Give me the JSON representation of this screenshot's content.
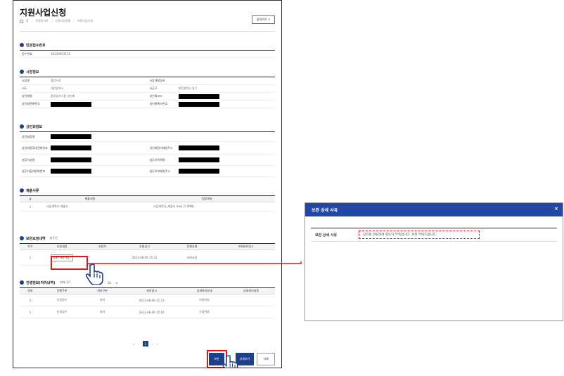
{
  "page": {
    "title": "지원사업신청",
    "breadcrumb": [
      "홈",
      "자원봉사자",
      "신청사업현황",
      "지원사업신청"
    ],
    "print_label": "출력하기 ↗"
  },
  "sections": {
    "receipt": {
      "title": "민원접수번호",
      "rows": [
        {
          "label": "접수번호",
          "value": "20230001111"
        }
      ]
    },
    "market": {
      "title": "시장정보",
      "rows": [
        {
          "l1": "시장명",
          "v1": "중앙시장",
          "l2": "시장개설일자",
          "v2": ""
        },
        {
          "l1": "시도",
          "v1": "대전광역시",
          "l2": "시군구",
          "v2": "대전광역시 동구"
        },
        {
          "l1": "상인회명",
          "v1": "중앙상가시장 상인회",
          "l2": "상인회코드",
          "v2": ""
        },
        {
          "l1": "상인회전화번호",
          "v1": "",
          "l2": "상인회팩스번호",
          "v2": ""
        }
      ]
    },
    "merchant": {
      "title": "상인회정보",
      "rows": [
        {
          "l1": "상인회장명",
          "l2": ""
        },
        {
          "l1": "상인회장휴대전화번호",
          "l2": "상인회장이메일주소"
        },
        {
          "l1": "실무자성명",
          "l2": "실무자직책명"
        },
        {
          "l1": "실무자휴대전화번호",
          "l2": "실무자이메일주소"
        }
      ]
    },
    "docs": {
      "title": "제출서류",
      "headers": [
        "#",
        "제출서류",
        "첨부파일"
      ],
      "rows": [
        {
          "no": "1",
          "name": "사업계획서 제출서",
          "file": "사업계획서_제출서.hwp (1.0MB)"
        }
      ]
    },
    "supplement": {
      "title": "보완요청내역",
      "count": "총 1건",
      "headers": [
        "차수",
        "요청내용",
        "요청자",
        "요청일시",
        "진행상태",
        "보완완료일시"
      ],
      "rows": [
        {
          "no": "1",
          "content_button": "보완 사유 확인",
          "requester": "",
          "date": "2023-08-09 15:31",
          "status": "보완요청",
          "done": ""
        }
      ]
    },
    "history": {
      "title": "진행정보(처리내역)",
      "meta": "현재 1/1",
      "per_page_label": "목록 수",
      "per_page_value": "10",
      "headers": [
        "번호",
        "진행구분",
        "처리구분",
        "처리일시",
        "상세처리상태",
        "상세처리내용"
      ],
      "rows": [
        {
          "no": "2",
          "kind": "신청접수",
          "proc": "처리",
          "date": "2023-08-09 15:31",
          "status": "보완요청",
          "detail": ""
        },
        {
          "no": "1",
          "kind": "신청접수",
          "proc": "처리",
          "date": "2023-08-09 15:16",
          "status": "신청완료",
          "detail": ""
        }
      ]
    }
  },
  "pager": {
    "current": "1",
    "prev": "‹",
    "next": "›",
    "first": "«",
    "last": "»"
  },
  "buttons": {
    "save": "보완",
    "detail": "상세보기",
    "delete": "삭제"
  },
  "popup": {
    "title": "보완 상세 사유",
    "close": "×",
    "label": "보완 상세 사유",
    "value": "상인회 관련하여 정보가 부족합니다. 보완 부탁드립니다."
  },
  "colors": {
    "accent": "#1f3f8b",
    "popup_header": "#2048a4",
    "highlight": "#e11111"
  }
}
